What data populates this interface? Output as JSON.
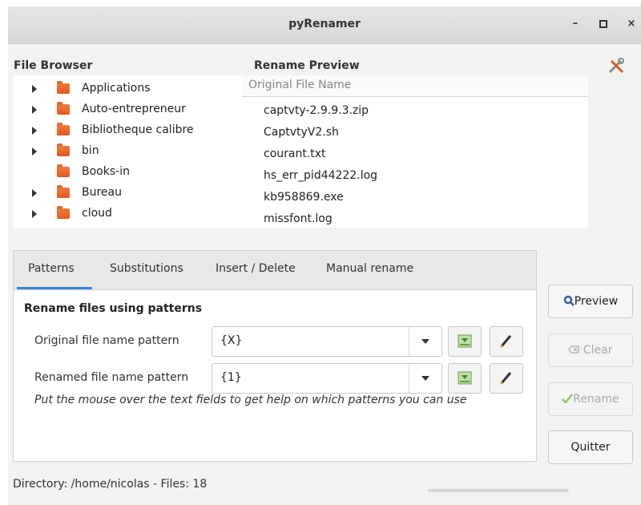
{
  "window": {
    "title": "pyRenamer",
    "minimize": "–",
    "maximize": "▫",
    "close": "×"
  },
  "file_browser": {
    "header": "File Browser",
    "items": [
      {
        "label": "Applications",
        "expandable": true
      },
      {
        "label": "Auto-entrepreneur",
        "expandable": true
      },
      {
        "label": "Bibliotheque calibre",
        "expandable": true
      },
      {
        "label": "bin",
        "expandable": true
      },
      {
        "label": "Books-in",
        "expandable": false
      },
      {
        "label": "Bureau",
        "expandable": true
      },
      {
        "label": "cloud",
        "expandable": true
      }
    ]
  },
  "rename_preview": {
    "header": "Rename Preview",
    "column": "Original File Name",
    "files": [
      "captvty-2.9.9.3.zip",
      "CaptvtyV2.sh",
      "courant.txt",
      "hs_err_pid44222.log",
      "kb958869.exe",
      "missfont.log"
    ]
  },
  "tabs": [
    {
      "label": "Patterns",
      "active": true
    },
    {
      "label": "Substitutions"
    },
    {
      "label": "Insert / Delete"
    },
    {
      "label": "Manual rename"
    }
  ],
  "patterns": {
    "title": "Rename files using patterns",
    "original_label": "Original file name pattern",
    "original_value": "{X}",
    "renamed_label": "Renamed file name pattern",
    "renamed_value": "{1}",
    "hint": "Put the mouse over the text fields to get help on which patterns you can use"
  },
  "buttons": {
    "preview": "Preview",
    "clear": "Clear",
    "rename": "Rename",
    "quit": "Quitter"
  },
  "status": "Directory: /home/nicolas - Files: 18",
  "colors": {
    "accent": "#3b82d6",
    "folder": "#e8622a"
  }
}
